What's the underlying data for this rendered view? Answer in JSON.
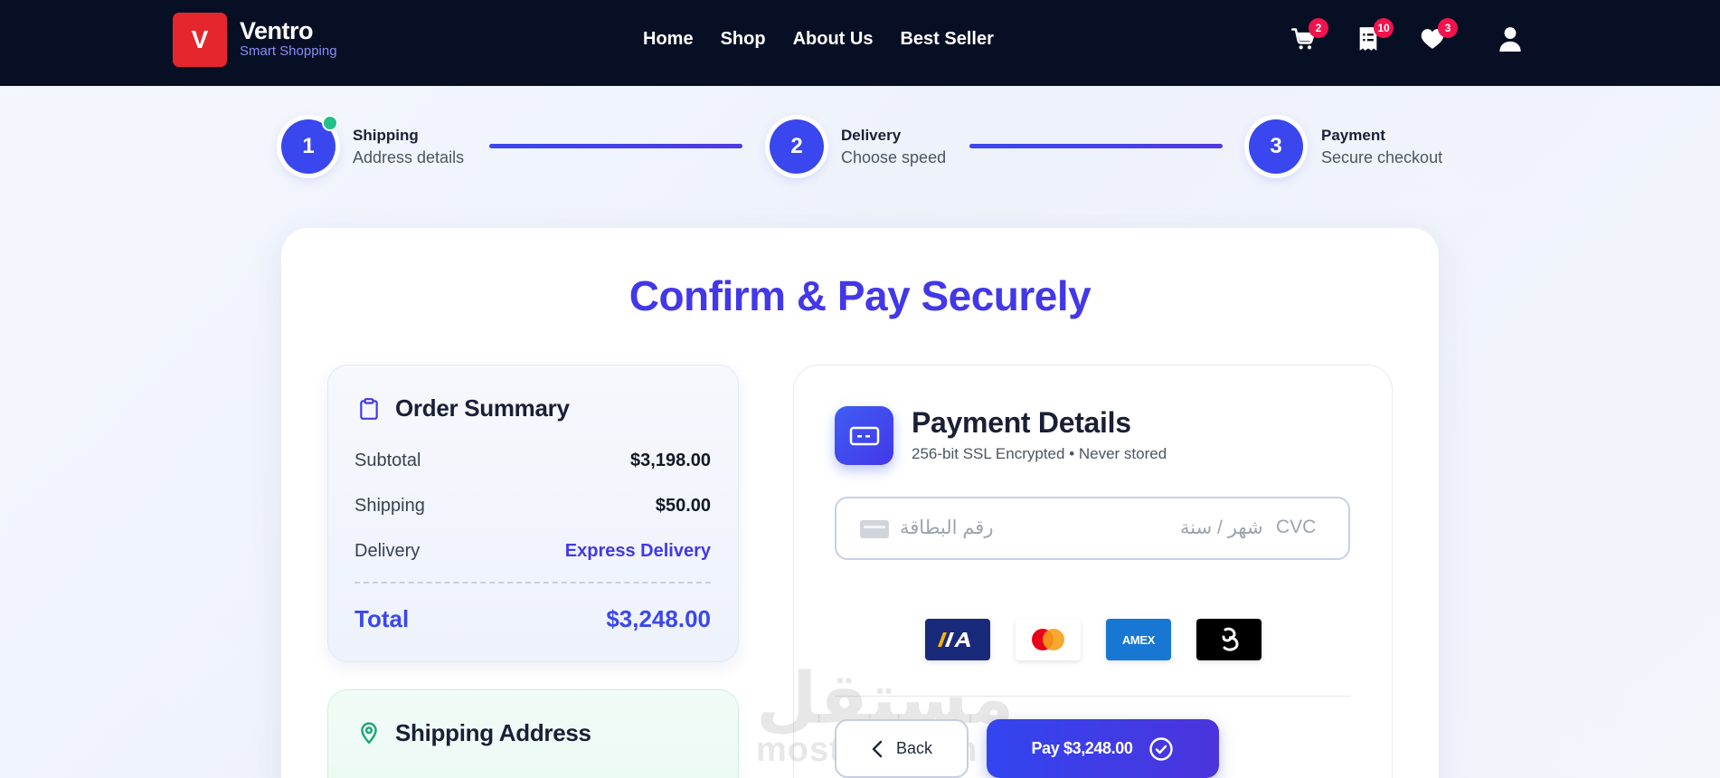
{
  "header": {
    "logo_letter": "V",
    "brand_name": "Ventro",
    "brand_tagline": "Smart Shopping",
    "nav": [
      "Home",
      "Shop",
      "About Us",
      "Best Seller"
    ],
    "cart_count": "2",
    "orders_count": "10",
    "wishlist_count": "3"
  },
  "stepper": {
    "steps": [
      {
        "number": "1",
        "title": "Shipping",
        "subtitle": "Address details"
      },
      {
        "number": "2",
        "title": "Delivery",
        "subtitle": "Choose speed"
      },
      {
        "number": "3",
        "title": "Payment",
        "subtitle": "Secure checkout"
      }
    ]
  },
  "page_title": "Confirm & Pay Securely",
  "summary": {
    "title": "Order Summary",
    "rows": [
      {
        "label": "Subtotal",
        "value": "$3,198.00"
      },
      {
        "label": "Shipping",
        "value": "$50.00"
      },
      {
        "label": "Delivery",
        "value": "Express Delivery"
      }
    ],
    "total_label": "Total",
    "total_value": "$3,248.00"
  },
  "shipping_address": {
    "title": "Shipping Address"
  },
  "payment": {
    "title": "Payment Details",
    "subtitle": "256-bit SSL Encrypted • Never stored",
    "card_number_placeholder": "رقم البطاقة",
    "expiry_placeholder": "شهر / سنة",
    "cvc_placeholder": "CVC",
    "brands": [
      "visa",
      "mastercard",
      "amex",
      "other"
    ],
    "amex_label": "AMEX",
    "back_label": "Back",
    "pay_label": "Pay $3,248.00"
  },
  "watermark": {
    "arabic": "مستقل",
    "latin": "mostaql.com"
  },
  "colors": {
    "navbar": "#070f24",
    "logo": "#e5262d",
    "accent": "#3a47ee",
    "badge": "#f0134d",
    "step_done_dot": "#22c08a"
  }
}
